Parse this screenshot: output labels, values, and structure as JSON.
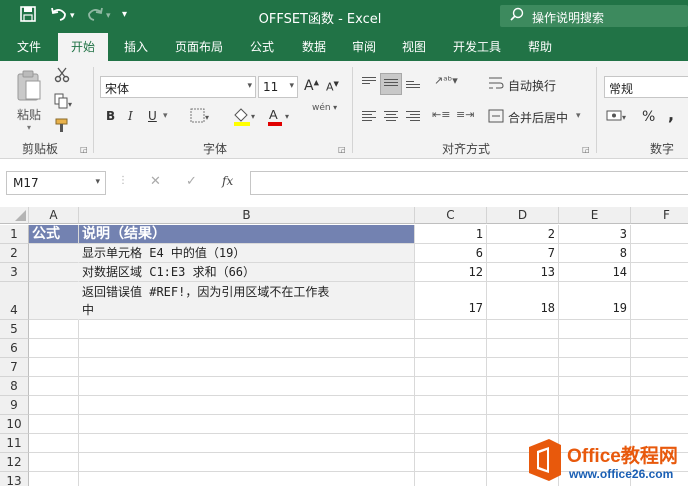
{
  "titlebar": {
    "title": "OFFSET函数  -  Excel",
    "search_placeholder": "操作说明搜索",
    "save_icon": "save-icon",
    "undo_icon": "undo-icon",
    "redo_icon": "redo-icon"
  },
  "tabs": [
    "文件",
    "开始",
    "插入",
    "页面布局",
    "公式",
    "数据",
    "审阅",
    "视图",
    "开发工具",
    "帮助"
  ],
  "active_tab": "开始",
  "ribbon": {
    "clipboard": {
      "paste": "粘贴",
      "label": "剪贴板"
    },
    "font": {
      "name": "宋体",
      "size": "11",
      "label": "字体",
      "bold": "B",
      "italic": "I",
      "underline": "U",
      "grow": "A",
      "shrink": "A",
      "font_color": "A",
      "wen": "wén"
    },
    "align": {
      "wrap": "自动换行",
      "merge": "合并后居中",
      "label": "对齐方式"
    },
    "number": {
      "format": "常规",
      "label": "数字",
      "percent": "%",
      "comma": ","
    }
  },
  "formula_bar": {
    "name_box": "M17",
    "fx": "fx",
    "cancel": "✕",
    "confirm": "✓",
    "value": ""
  },
  "grid": {
    "columns": [
      "A",
      "B",
      "C",
      "D",
      "E",
      "F"
    ],
    "rows": [
      "1",
      "2",
      "3",
      "4",
      "5",
      "6",
      "7",
      "8",
      "9",
      "10",
      "11",
      "12",
      "13"
    ],
    "r1": {
      "a": "公式",
      "b": "说明（结果）",
      "c": "1",
      "d": "2",
      "e": "3"
    },
    "r2": {
      "b": "显示单元格 E4 中的值（19）",
      "c": "6",
      "d": "7",
      "e": "8"
    },
    "r3": {
      "b": "对数据区域 C1:E3 求和（66）",
      "c": "12",
      "d": "13",
      "e": "14"
    },
    "r4": {
      "b1": "返回错误值 #REF!，因为引用区域不在工作表",
      "b2": "中",
      "c": "17",
      "d": "18",
      "e": "19"
    }
  },
  "colors": {
    "excel_green": "#217346",
    "header_band": "#7382b1",
    "gray_fill": "#f2f2f2"
  },
  "watermark": {
    "brand": "Office教程网",
    "url": "www.office26.com"
  }
}
